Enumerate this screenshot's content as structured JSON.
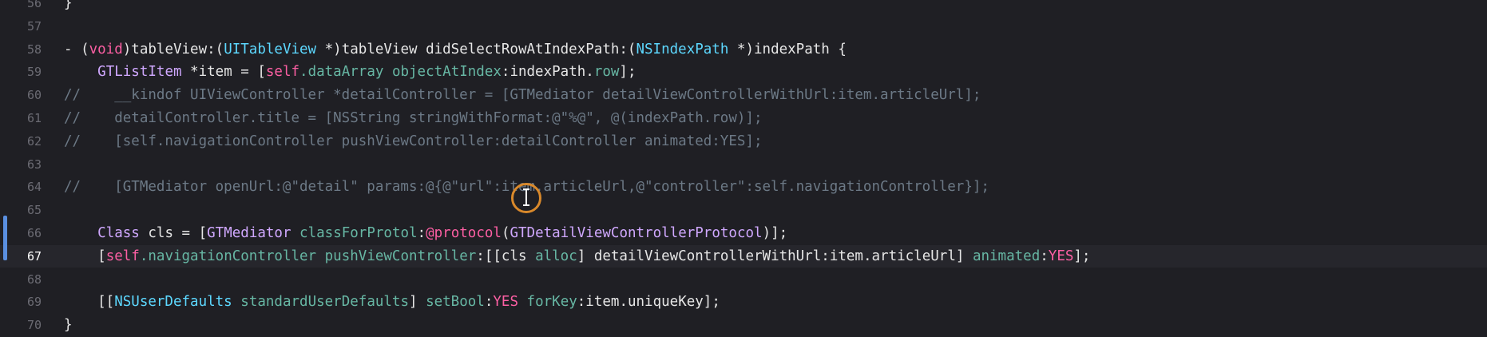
{
  "editor": {
    "current_line": "67",
    "lines": [
      {
        "number": "56",
        "tokens": [
          {
            "t": "}",
            "c": "plain"
          }
        ]
      },
      {
        "number": "57",
        "tokens": []
      },
      {
        "number": "58",
        "tokens": [
          {
            "t": "- (",
            "c": "plain"
          },
          {
            "t": "void",
            "c": "kw"
          },
          {
            "t": ")tableView:(",
            "c": "plain"
          },
          {
            "t": "UITableView",
            "c": "type"
          },
          {
            "t": " *)tableView didSelectRowAtIndexPath:(",
            "c": "plain"
          },
          {
            "t": "NSIndexPath",
            "c": "type"
          },
          {
            "t": " *)indexPath {",
            "c": "plain"
          }
        ]
      },
      {
        "number": "59",
        "tokens": [
          {
            "t": "    ",
            "c": "plain"
          },
          {
            "t": "GTListItem",
            "c": "cls"
          },
          {
            "t": " *item = [",
            "c": "plain"
          },
          {
            "t": "self",
            "c": "kw"
          },
          {
            "t": ".dataArray ",
            "c": "method"
          },
          {
            "t": "objectAtIndex",
            "c": "method"
          },
          {
            "t": ":indexPath.",
            "c": "plain"
          },
          {
            "t": "row",
            "c": "method"
          },
          {
            "t": "];",
            "c": "plain"
          }
        ]
      },
      {
        "number": "60",
        "tokens": [
          {
            "t": "//    __kindof UIViewController *detailController = [GTMediator detailViewControllerWithUrl:item.articleUrl];",
            "c": "comment"
          }
        ]
      },
      {
        "number": "61",
        "tokens": [
          {
            "t": "//    detailController.title = [NSString stringWithFormat:@\"%@\", @(indexPath.row)];",
            "c": "comment"
          }
        ]
      },
      {
        "number": "62",
        "tokens": [
          {
            "t": "//    [self.navigationController pushViewController:detailController animated:YES];",
            "c": "comment"
          }
        ]
      },
      {
        "number": "63",
        "tokens": []
      },
      {
        "number": "64",
        "tokens": [
          {
            "t": "//    [GTMediator openUrl:@\"detail\" params:@{@\"url\":item.articleUrl,@\"controller\":self.navigationController}];",
            "c": "comment"
          }
        ]
      },
      {
        "number": "65",
        "tokens": []
      },
      {
        "number": "66",
        "tokens": [
          {
            "t": "    ",
            "c": "plain"
          },
          {
            "t": "Class",
            "c": "cls"
          },
          {
            "t": " cls = [",
            "c": "plain"
          },
          {
            "t": "GTMediator",
            "c": "cls"
          },
          {
            "t": " ",
            "c": "plain"
          },
          {
            "t": "classForProtol",
            "c": "method"
          },
          {
            "t": ":",
            "c": "plain"
          },
          {
            "t": "@protocol",
            "c": "kw"
          },
          {
            "t": "(",
            "c": "plain"
          },
          {
            "t": "GTDetailViewControllerProtocol",
            "c": "cls"
          },
          {
            "t": ")];",
            "c": "plain"
          }
        ]
      },
      {
        "number": "67",
        "tokens": [
          {
            "t": "    [",
            "c": "plain"
          },
          {
            "t": "self",
            "c": "kw"
          },
          {
            "t": ".navigationController ",
            "c": "method"
          },
          {
            "t": "pushViewController",
            "c": "method"
          },
          {
            "t": ":[[cls ",
            "c": "plain"
          },
          {
            "t": "alloc",
            "c": "method"
          },
          {
            "t": "] detailViewControllerWithUrl:item.articleUrl] ",
            "c": "plain"
          },
          {
            "t": "animated",
            "c": "method"
          },
          {
            "t": ":",
            "c": "plain"
          },
          {
            "t": "YES",
            "c": "kw"
          },
          {
            "t": "];",
            "c": "plain"
          }
        ]
      },
      {
        "number": "68",
        "tokens": []
      },
      {
        "number": "69",
        "tokens": [
          {
            "t": "    [[",
            "c": "plain"
          },
          {
            "t": "NSUserDefaults",
            "c": "type"
          },
          {
            "t": " ",
            "c": "plain"
          },
          {
            "t": "standardUserDefaults",
            "c": "method"
          },
          {
            "t": "] ",
            "c": "plain"
          },
          {
            "t": "setBool",
            "c": "method"
          },
          {
            "t": ":",
            "c": "plain"
          },
          {
            "t": "YES",
            "c": "kw"
          },
          {
            "t": " ",
            "c": "plain"
          },
          {
            "t": "forKey",
            "c": "method"
          },
          {
            "t": ":item.uniqueKey];",
            "c": "plain"
          }
        ]
      },
      {
        "number": "70",
        "tokens": [
          {
            "t": "}",
            "c": "plain"
          }
        ]
      }
    ]
  },
  "cursor": {
    "icon": "i-beam-icon",
    "ring_color": "#d9892b"
  },
  "gutter_marks": {
    "changed_color": "#5a8fe0"
  }
}
